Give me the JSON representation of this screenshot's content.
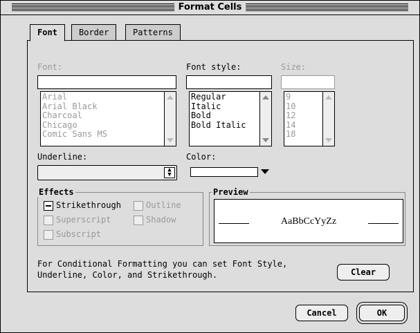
{
  "window": {
    "title": "Format Cells"
  },
  "tabs": [
    {
      "label": "Font",
      "active": true
    },
    {
      "label": "Border",
      "active": false
    },
    {
      "label": "Patterns",
      "active": false
    }
  ],
  "font": {
    "label": "Font:",
    "value": "",
    "list": [
      "Arial",
      "Arial Black",
      "Charcoal",
      "Chicago",
      "Comic Sans MS"
    ]
  },
  "font_style": {
    "label": "Font style:",
    "value": "",
    "list": [
      "Regular",
      "Italic",
      "Bold",
      "Bold Italic"
    ]
  },
  "size": {
    "label": "Size:",
    "value": "",
    "list": [
      "9",
      "10",
      "12",
      "14",
      "18"
    ]
  },
  "underline": {
    "label": "Underline:",
    "value": ""
  },
  "color": {
    "label": "Color:",
    "value": ""
  },
  "effects": {
    "title": "Effects",
    "strikethrough": "Strikethrough",
    "superscript": "Superscript",
    "subscript": "Subscript",
    "outline": "Outline",
    "shadow": "Shadow"
  },
  "preview": {
    "title": "Preview",
    "sample": "AaBbCcYyZz"
  },
  "info_text_line1": "For Conditional Formatting you can set Font Style,",
  "info_text_line2": "Underline, Color, and Strikethrough.",
  "buttons": {
    "clear": "Clear",
    "cancel": "Cancel",
    "ok": "OK"
  }
}
